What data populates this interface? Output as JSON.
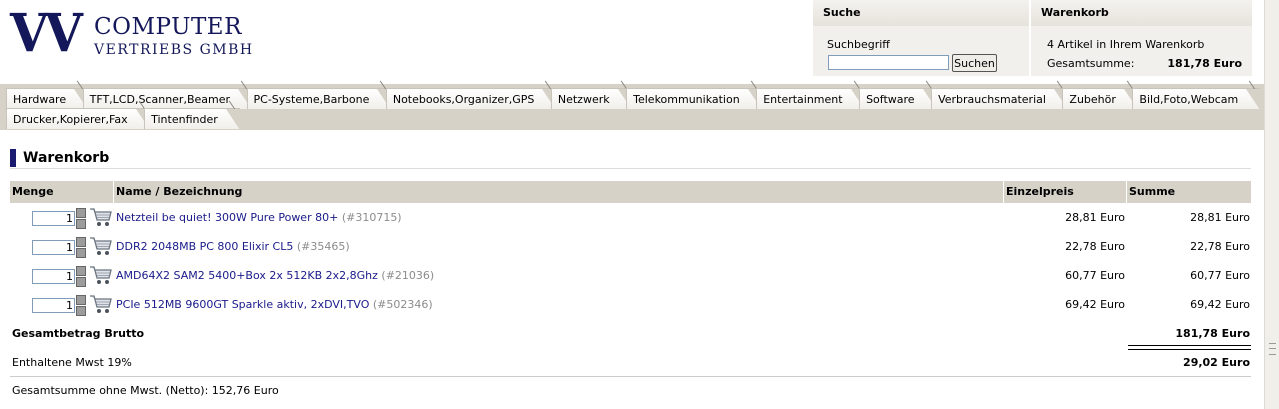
{
  "header": {
    "logo_vv": "VV",
    "logo_line1": "COMPUTER",
    "logo_line2": "VERTRIEBS GMBH"
  },
  "search": {
    "title": "Suche",
    "label": "Suchbegriff",
    "value": "",
    "button_label": "Suchen"
  },
  "cart_box": {
    "title": "Warenkorb",
    "count_text": "4 Artikel in Ihrem Warenkorb",
    "total_label": "Gesamtsumme:",
    "total_value": "181,78 Euro"
  },
  "nav": {
    "row1": [
      "Hardware",
      "TFT,LCD,Scanner,Beamer",
      "PC-Systeme,Barbone",
      "Notebooks,Organizer,GPS",
      "Netzwerk",
      "Telekommunikation",
      "Entertainment",
      "Software",
      "Verbrauchsmaterial",
      "Zubehör",
      "Bild,Foto,Webcam"
    ],
    "row2": [
      "Drucker,Kopierer,Fax",
      "Tintenfinder"
    ]
  },
  "cart": {
    "title": "Warenkorb",
    "columns": {
      "qty": "Menge",
      "name": "Name / Bezeichnung",
      "unit_price": "Einzelpreis",
      "sum": "Summe"
    },
    "items": [
      {
        "qty": "1",
        "name": "Netzteil be quiet! 300W Pure Power 80+",
        "sku": "(#310715)",
        "unit_price": "28,81 Euro",
        "sum": "28,81 Euro"
      },
      {
        "qty": "1",
        "name": "DDR2 2048MB PC 800 Elixir CL5",
        "sku": "(#35465)",
        "unit_price": "22,78 Euro",
        "sum": "22,78 Euro"
      },
      {
        "qty": "1",
        "name": "AMD64X2 SAM2 5400+Box 2x 512KB 2x2,8Ghz",
        "sku": "(#21036)",
        "unit_price": "60,77 Euro",
        "sum": "60,77 Euro"
      },
      {
        "qty": "1",
        "name": "PCIe 512MB 9600GT Sparkle aktiv, 2xDVI,TVO",
        "sku": "(#502346)",
        "unit_price": "69,42 Euro",
        "sum": "69,42 Euro"
      }
    ],
    "total_label": "Gesamtbetrag Brutto",
    "total_value": "181,78 Euro",
    "vat_label": "Enthaltene Mwst 19%",
    "vat_value": "29,02 Euro",
    "net_label": "Gesamtsumme ohne Mwst. (Netto): 152,76 Euro"
  }
}
